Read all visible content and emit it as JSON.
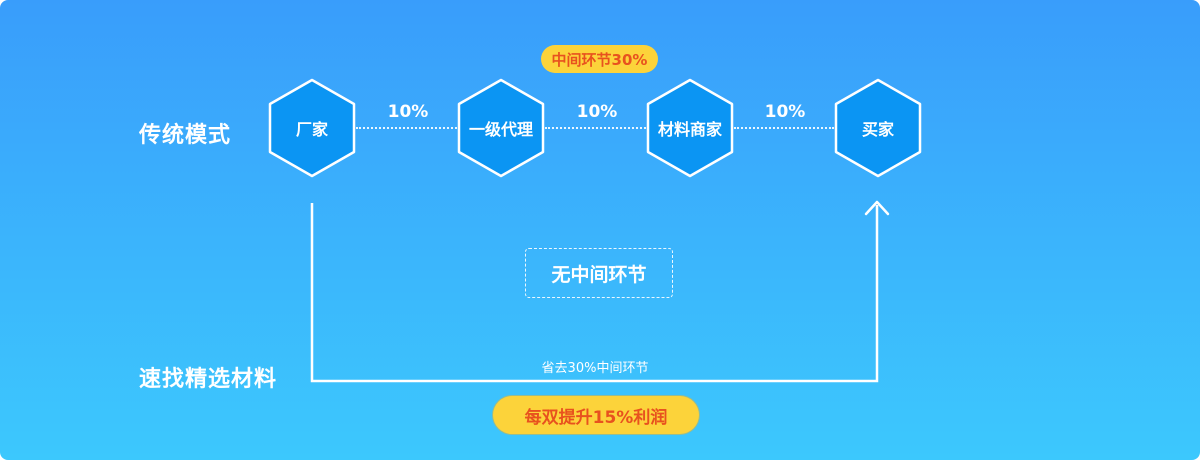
{
  "rows": {
    "traditional_label": "传统模式",
    "direct_label": "速找精选材料"
  },
  "nodes": [
    {
      "label": "厂家"
    },
    {
      "label": "一级代理"
    },
    {
      "label": "材料商家"
    },
    {
      "label": "买家"
    }
  ],
  "margins": [
    "10%",
    "10%",
    "10%"
  ],
  "middle_total_pill": "中间环节30%",
  "no_middle_label": "无中间环节",
  "saved_label": "省去30%中间环节",
  "profit_pill": "每双提升15%利润",
  "colors": {
    "background_top": "#399dfb",
    "background_bottom": "#3cc8fd",
    "hex_fill": "#0b95f3",
    "pill_fill": "#fcd33a",
    "pill_text": "#e8521e"
  }
}
